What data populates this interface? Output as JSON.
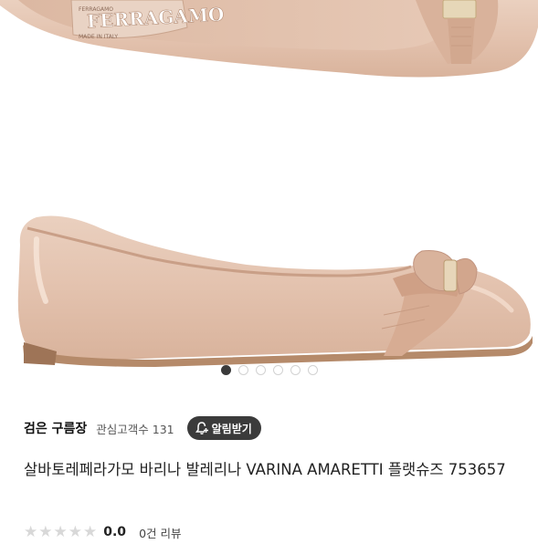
{
  "gallery": {
    "insole_brand": "FERRAGAMO",
    "insole_small_1": "FERRAGAMO",
    "insole_small_2": "MADE IN ITALY",
    "slide_count": 6,
    "active_slide": 1
  },
  "seller": {
    "name": "검은 구름장",
    "interest_label": "관심고객수 131",
    "alarm_label": "알림받기"
  },
  "product": {
    "title": "살바토레페라가모 바리나 발레리나 VARINA AMARETTI 플랫슈즈 753657"
  },
  "rating": {
    "icon": "star-icon",
    "score": "0.0",
    "reviews": "0건 리뷰",
    "star_color": "#d8d8d8"
  },
  "colors": {
    "shoe": "#e8c9b6",
    "alarm_button": "#3b3b3b"
  }
}
